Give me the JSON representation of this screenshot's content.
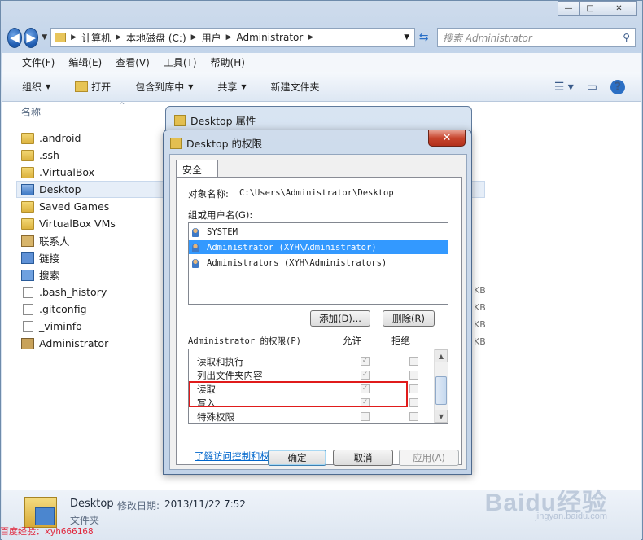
{
  "explorer": {
    "controls": {
      "minimize": "—",
      "maximize": "□",
      "close": "✕"
    },
    "nav": {
      "back": "◀",
      "forward": "▶"
    },
    "address": [
      "计算机",
      "本地磁盘 (C:)",
      "用户",
      "Administrator"
    ],
    "search_placeholder": "搜索 Administrator",
    "menu": [
      "文件(F)",
      "编辑(E)",
      "查看(V)",
      "工具(T)",
      "帮助(H)"
    ],
    "commands": {
      "organize": "组织",
      "open": "打开",
      "include": "包含到库中",
      "share": "共享",
      "new_folder": "新建文件夹"
    },
    "column_name": "名称",
    "files": [
      {
        "name": ".android",
        "icon": "folder"
      },
      {
        "name": ".ssh",
        "icon": "folder"
      },
      {
        "name": ".VirtualBox",
        "icon": "folder"
      },
      {
        "name": "Desktop",
        "icon": "folder-blue",
        "selected": true
      },
      {
        "name": "Saved Games",
        "icon": "folder"
      },
      {
        "name": "VirtualBox VMs",
        "icon": "folder"
      },
      {
        "name": "联系人",
        "icon": "contacts"
      },
      {
        "name": "链接",
        "icon": "links"
      },
      {
        "name": "搜索",
        "icon": "search-f"
      },
      {
        "name": ".bash_history",
        "icon": "doc"
      },
      {
        "name": ".gitconfig",
        "icon": "doc"
      },
      {
        "name": "_viminfo",
        "icon": "doc"
      },
      {
        "name": "Administrator",
        "icon": "user"
      }
    ],
    "size_suffix": "KB",
    "details": {
      "name": "Desktop",
      "modified_label": "修改日期:",
      "modified_value": "2013/11/22 7:52",
      "type": "文件夹"
    }
  },
  "props_dialog": {
    "title": "Desktop 属性"
  },
  "perm_dialog": {
    "title": "Desktop 的权限",
    "close": "✕",
    "tab": "安全",
    "object_label": "对象名称:",
    "object_value": "C:\\Users\\Administrator\\Desktop",
    "group_label": "组或用户名(G):",
    "users": [
      {
        "name": "SYSTEM"
      },
      {
        "name": "Administrator (XYH\\Administrator)",
        "selected": true
      },
      {
        "name": "Administrators (XYH\\Administrators)"
      }
    ],
    "add_btn": "添加(D)...",
    "remove_btn": "删除(R)",
    "perm_header": "Administrator 的权限(P)",
    "allow": "允许",
    "deny": "拒绝",
    "permissions": [
      {
        "name": "读取和执行",
        "allow": true,
        "deny": false
      },
      {
        "name": "列出文件夹内容",
        "allow": true,
        "deny": false
      },
      {
        "name": "读取",
        "allow": true,
        "deny": false
      },
      {
        "name": "写入",
        "allow": true,
        "deny": false
      },
      {
        "name": "特殊权限",
        "allow": false,
        "deny": false
      }
    ],
    "link": "了解访问控制和权限",
    "ok": "确定",
    "cancel": "取消",
    "apply": "应用(A)"
  },
  "watermark": {
    "left": "百度经验：xyh666168",
    "brand": "Baidu经验",
    "url": "jingyan.baidu.com"
  }
}
